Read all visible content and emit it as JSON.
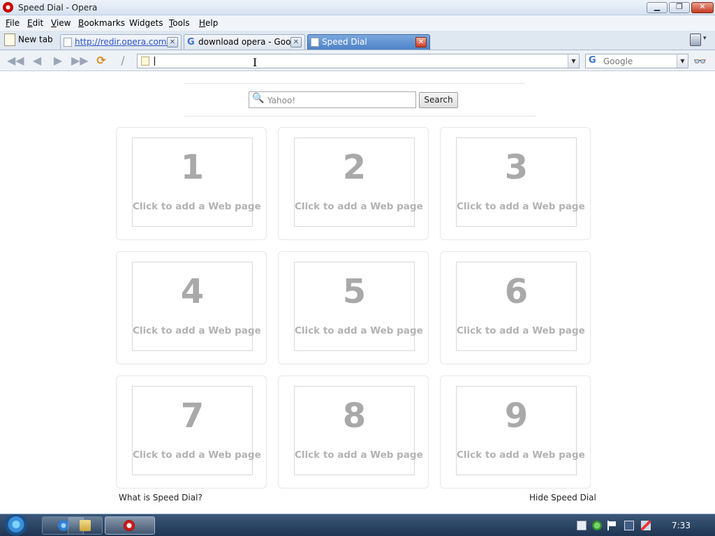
{
  "window": {
    "title": "Speed Dial - Opera",
    "min_glyph": "▁",
    "max_glyph": "❐",
    "close_glyph": "✕"
  },
  "menu": [
    {
      "label": "File",
      "key": "F",
      "rest": "ile"
    },
    {
      "label": "Edit",
      "key": "E",
      "rest": "dit"
    },
    {
      "label": "View",
      "key": "V",
      "rest": "iew"
    },
    {
      "label": "Bookmarks",
      "key": "B",
      "rest": "ookmarks"
    },
    {
      "label": "Widgets",
      "key": "",
      "rest": "Widgets"
    },
    {
      "label": "Tools",
      "key": "T",
      "rest": "ools"
    },
    {
      "label": "Help",
      "key": "H",
      "rest": "elp"
    }
  ],
  "tabs": {
    "new_tab_label": "New tab",
    "items": [
      {
        "label": "http://redir.opera.com...",
        "color": "#2d55c9",
        "active": false
      },
      {
        "label": "download opera - Goo...",
        "color": "#222222",
        "active": false
      },
      {
        "label": "Speed Dial",
        "color": "#ffffff",
        "active": true
      }
    ],
    "close_glyph": "✕",
    "trash_caret": "▾"
  },
  "toolbar": {
    "back_glyph": "◀◀",
    "prev_glyph": "◀",
    "next_glyph": "▶",
    "forward_glyph": "▶▶",
    "reload_glyph": "⟳",
    "edit_glyph": "/",
    "address_value": "",
    "dropdown_glyph": "▼",
    "search_engine": "Google",
    "glasses_glyph": "👓"
  },
  "speed_dial": {
    "search_placeholder": "Yahoo!",
    "search_button": "Search",
    "cells": [
      {
        "number": "1",
        "cta": "Click to add a Web page"
      },
      {
        "number": "2",
        "cta": "Click to add a Web page"
      },
      {
        "number": "3",
        "cta": "Click to add a Web page"
      },
      {
        "number": "4",
        "cta": "Click to add a Web page"
      },
      {
        "number": "5",
        "cta": "Click to add a Web page"
      },
      {
        "number": "6",
        "cta": "Click to add a Web page"
      },
      {
        "number": "7",
        "cta": "Click to add a Web page"
      },
      {
        "number": "8",
        "cta": "Click to add a Web page"
      },
      {
        "number": "9",
        "cta": "Click to add a Web page"
      }
    ],
    "what_is_link": "What is Speed Dial?",
    "hide_link": "Hide Speed Dial"
  },
  "taskbar": {
    "clock": "7:33"
  },
  "colors": {
    "accent_tab": "#4d82c7",
    "close_red": "#cc3a22",
    "taskbar": "#1f3553"
  }
}
